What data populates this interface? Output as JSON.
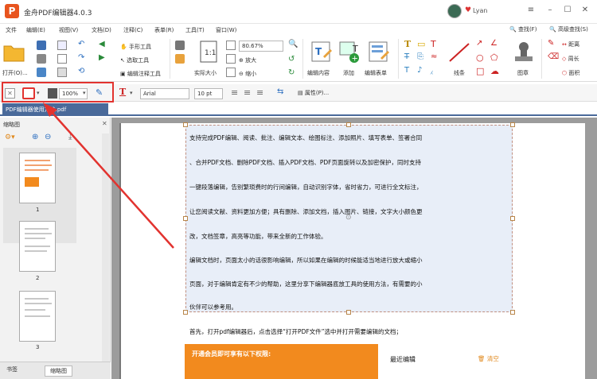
{
  "app": {
    "title": "金舟PDF编辑器4.0.3",
    "username": "Lyan",
    "logo_letter": "P"
  },
  "menu": [
    "文件",
    "编辑(E)",
    "视图(V)",
    "文档(D)",
    "注释(C)",
    "表单(R)",
    "工具(T)",
    "窗口(W)"
  ],
  "right_tools": {
    "find": "查找(F)",
    "adv_find": "高级查找(S)"
  },
  "ribbon": {
    "open": "打开(O)...",
    "hand_tool": "手形工具",
    "select_tool": "选取工具",
    "edit_annot_tool": "编辑注释工具",
    "actual_size": "实际大小",
    "zoom_value": "80.67%",
    "zoom_in": "放大",
    "zoom_out": "缩小",
    "edit_content": "编辑内容",
    "add": "添加",
    "edit_form": "编辑表单",
    "line": "线条",
    "stamp": "图章",
    "distance": "距离",
    "perimeter": "周长",
    "area": "面积"
  },
  "propbar": {
    "opacity": "100%",
    "font": "Arial",
    "size": "10 pt",
    "properties": "属性(P)..."
  },
  "doc_tab": "PDF编辑器使用方法.pdf",
  "sidebar": {
    "title": "缩略图",
    "pages": [
      "1",
      "2",
      "3"
    ],
    "tab_bookmarks": "书签",
    "tab_thumbs": "缩略图"
  },
  "content": {
    "lines": [
      "支持完成PDF编辑、阅读、批注、编辑文本、绘图标注、添加照片、填写表单、签署合同",
      "、合并PDF文档、删除PDF文档、插入PDF文档、PDF页面旋转以及加密保护，同时支持",
      "一键段落编辑，告别繁琐费时的行间编辑，自动识别字体，省时省力，可进行全文标注，",
      "让您阅读文献、资料更加方便；具有删除、添加文档，插入图片、链接，文字大小颜色更",
      "改，文档签章，高亮等功能，带来全新的工作体验。",
      "编辑文档时，页面太小的话很影响编辑，所以如果在编辑的时候能适当地进行放大或缩小",
      "页面，对于编辑肯定有不少的帮助，这里分享下编辑器底放工具的使用方法，有需要的小",
      "伙伴可以参考用。"
    ],
    "below_text": "首先，打开pdf编辑器后，点击选择“打开PDF文件”选中并打开需要编辑的文档；",
    "banner_text": "开通会员即可享有以下权限:",
    "recent_label": "最近编辑",
    "clear_label": "清空"
  },
  "colors": {
    "accent": "#e2332f",
    "tab": "#4a6a9a",
    "banner": "#f28a1e",
    "logo": "#e8541e"
  }
}
